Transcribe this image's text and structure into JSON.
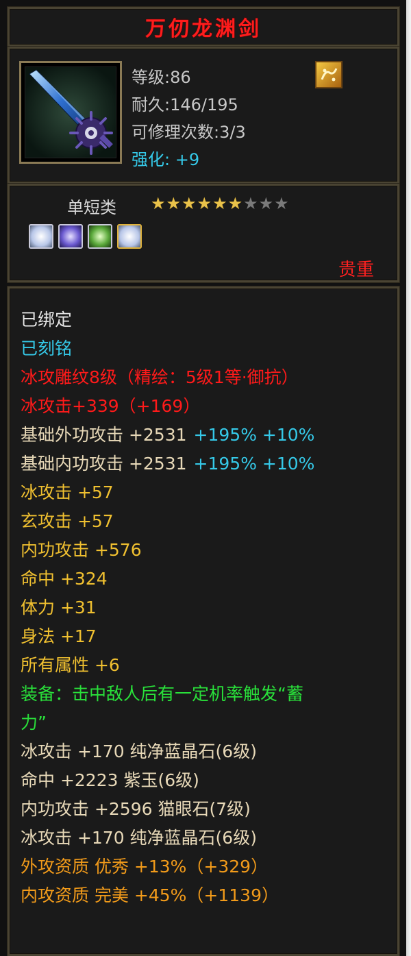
{
  "item": {
    "name": "万仞龙渊剑",
    "stats": {
      "level": "等级:86",
      "durability": "耐久:146/195",
      "repairs": "可修理次数:3/3",
      "enhance_label": "强化:",
      "enhance_value": "+9"
    },
    "category": "单短类",
    "stars": {
      "filled": 6,
      "total": 9
    },
    "rarity": "贵重",
    "badge_icon": "gold-rune-icon",
    "item_icon": "dragon-sword-icon",
    "sockets": [
      "white-gem-icon",
      "purple-gem-icon",
      "green-gem-icon",
      "white-gem-gold-frame-icon"
    ]
  },
  "attributes": [
    {
      "text": "已绑定",
      "color": "white"
    },
    {
      "text": "已刻铭",
      "color": "cyan"
    },
    {
      "text": "冰攻雕纹8级（精绘：5级1等·御抗）",
      "color": "red"
    },
    {
      "text": "冰攻击+339（+169）",
      "color": "red"
    },
    {
      "text": "基础外功攻击 +2531",
      "extra": "+195% +10%",
      "color": "beige"
    },
    {
      "text": "基础内功攻击 +2531",
      "extra": "+195% +10%",
      "color": "beige"
    },
    {
      "text": "冰攻击 +57",
      "color": "yellow"
    },
    {
      "text": "玄攻击 +57",
      "color": "yellow"
    },
    {
      "text": "内功攻击 +576",
      "color": "yellow"
    },
    {
      "text": "命中 +324",
      "color": "yellow"
    },
    {
      "text": "体力 +31",
      "color": "yellow"
    },
    {
      "text": "身法 +17",
      "color": "yellow"
    },
    {
      "text": "所有属性 +6",
      "color": "yellow"
    },
    {
      "text": "装备：击中敌人后有一定机率触发“蓄",
      "color": "green"
    },
    {
      "text": "力”",
      "color": "green"
    },
    {
      "text": "冰攻击 +170 纯净蓝晶石(6级)",
      "color": "beige"
    },
    {
      "text": "命中 +2223 紫玉(6级)",
      "color": "beige"
    },
    {
      "text": "内功攻击 +2596 猫眼石(7级)",
      "color": "beige"
    },
    {
      "text": "冰攻击 +170 纯净蓝晶石(6级)",
      "color": "beige"
    },
    {
      "text": "外攻资质  优秀 +13%（+329）",
      "color": "orange"
    },
    {
      "text": "内攻资质  完美 +45%（+1139）",
      "color": "orange"
    }
  ],
  "colors": {
    "white": "#e6e6e6",
    "cyan": "#35c9e8",
    "red": "#ff1a1a",
    "beige": "#e8d9b8",
    "yellow": "#f0c030",
    "green": "#29e03a",
    "orange": "#f29b1a",
    "title": "#ff1c1c",
    "frame": "#4a4433"
  }
}
